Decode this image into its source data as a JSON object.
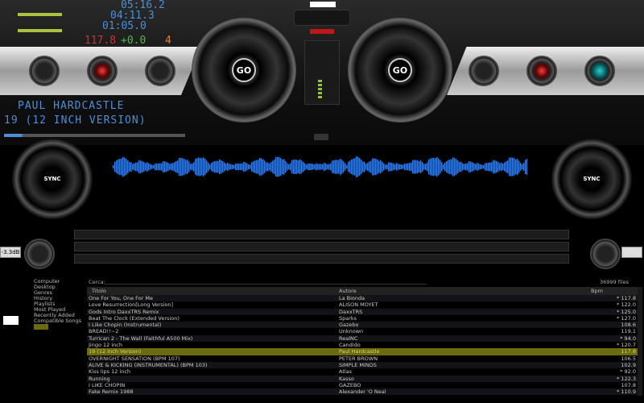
{
  "deck_left": {
    "time_elapsed": "05:16.2",
    "time_remaining": "04:11.3",
    "time_cue": "01:05.0",
    "bpm": "117.8",
    "pitch": "+0.0",
    "key": "4",
    "artist": "PAUL HARDCASTLE",
    "title": "19 (12 INCH VERSION)",
    "platter_label": "GO",
    "sync_label": "SYNC",
    "gain": "-3.3dB"
  },
  "deck_right": {
    "platter_label": "GO",
    "sync_label": "SYNC"
  },
  "browser": {
    "tree": [
      "Computer",
      "Desktop",
      "Genres",
      "History",
      "Playlists",
      "Most Played",
      "Recently Added",
      "Compatible Songs",
      ""
    ],
    "search_label": "Cerca:",
    "search_value": "",
    "file_count": "36999 files",
    "columns": [
      "Titolo",
      "Autore",
      "Bpm"
    ],
    "rows": [
      [
        "One For You,  One For Me",
        "La Bionda",
        "* 117.8"
      ],
      [
        "Love Resurrection[Long Version]",
        "ALISON MOYET",
        "* 122.0"
      ],
      [
        "Gods Intro DaxxTRS Remix",
        "DaxxTRS",
        "* 125.0"
      ],
      [
        "Beat The Clock (Extended Version)",
        "Sparks",
        "* 127.0"
      ],
      [
        "I Like Chopin (Instrumental)",
        "Gazebo",
        "108.6"
      ],
      [
        "BREAD!!~2",
        "Unknown",
        "119.1"
      ],
      [
        "Turrican 2 - The Wall (Faithful A500 Mix)",
        "RealNC",
        "* 94.0"
      ],
      [
        "Jingo 12 inch",
        "Candido",
        "* 120.7"
      ],
      [
        "19 (12 Inch Version)",
        "Paul Hardcastle",
        "117.8"
      ],
      [
        "OVERNIGHT SENSATION (BPM 107)",
        "PETER BROWN",
        "106.5"
      ],
      [
        "ALIVE & KICKING (INSTRUMENTAL) (BPM 103)",
        "SIMPLE MINDS",
        "102.9"
      ],
      [
        "Kiss lips 12 inch",
        "Atlas",
        "* 92.0"
      ],
      [
        "Running",
        "Kasso",
        "* 122.3"
      ],
      [
        "I LIKE CHOPIN",
        "GAZEBO",
        "107.8"
      ],
      [
        "Fake Remix 1988",
        "Alexander 'O Neal",
        "* 110.9"
      ]
    ],
    "selected_row": 8
  },
  "colors": {
    "waveform": "#3a7fe0",
    "selected_row": "#6b6a10",
    "lcd_blue": "#4a8fd8",
    "bpm_red": "#d03030",
    "pitch_green": "#40c040",
    "key_orange": "#e08030"
  }
}
